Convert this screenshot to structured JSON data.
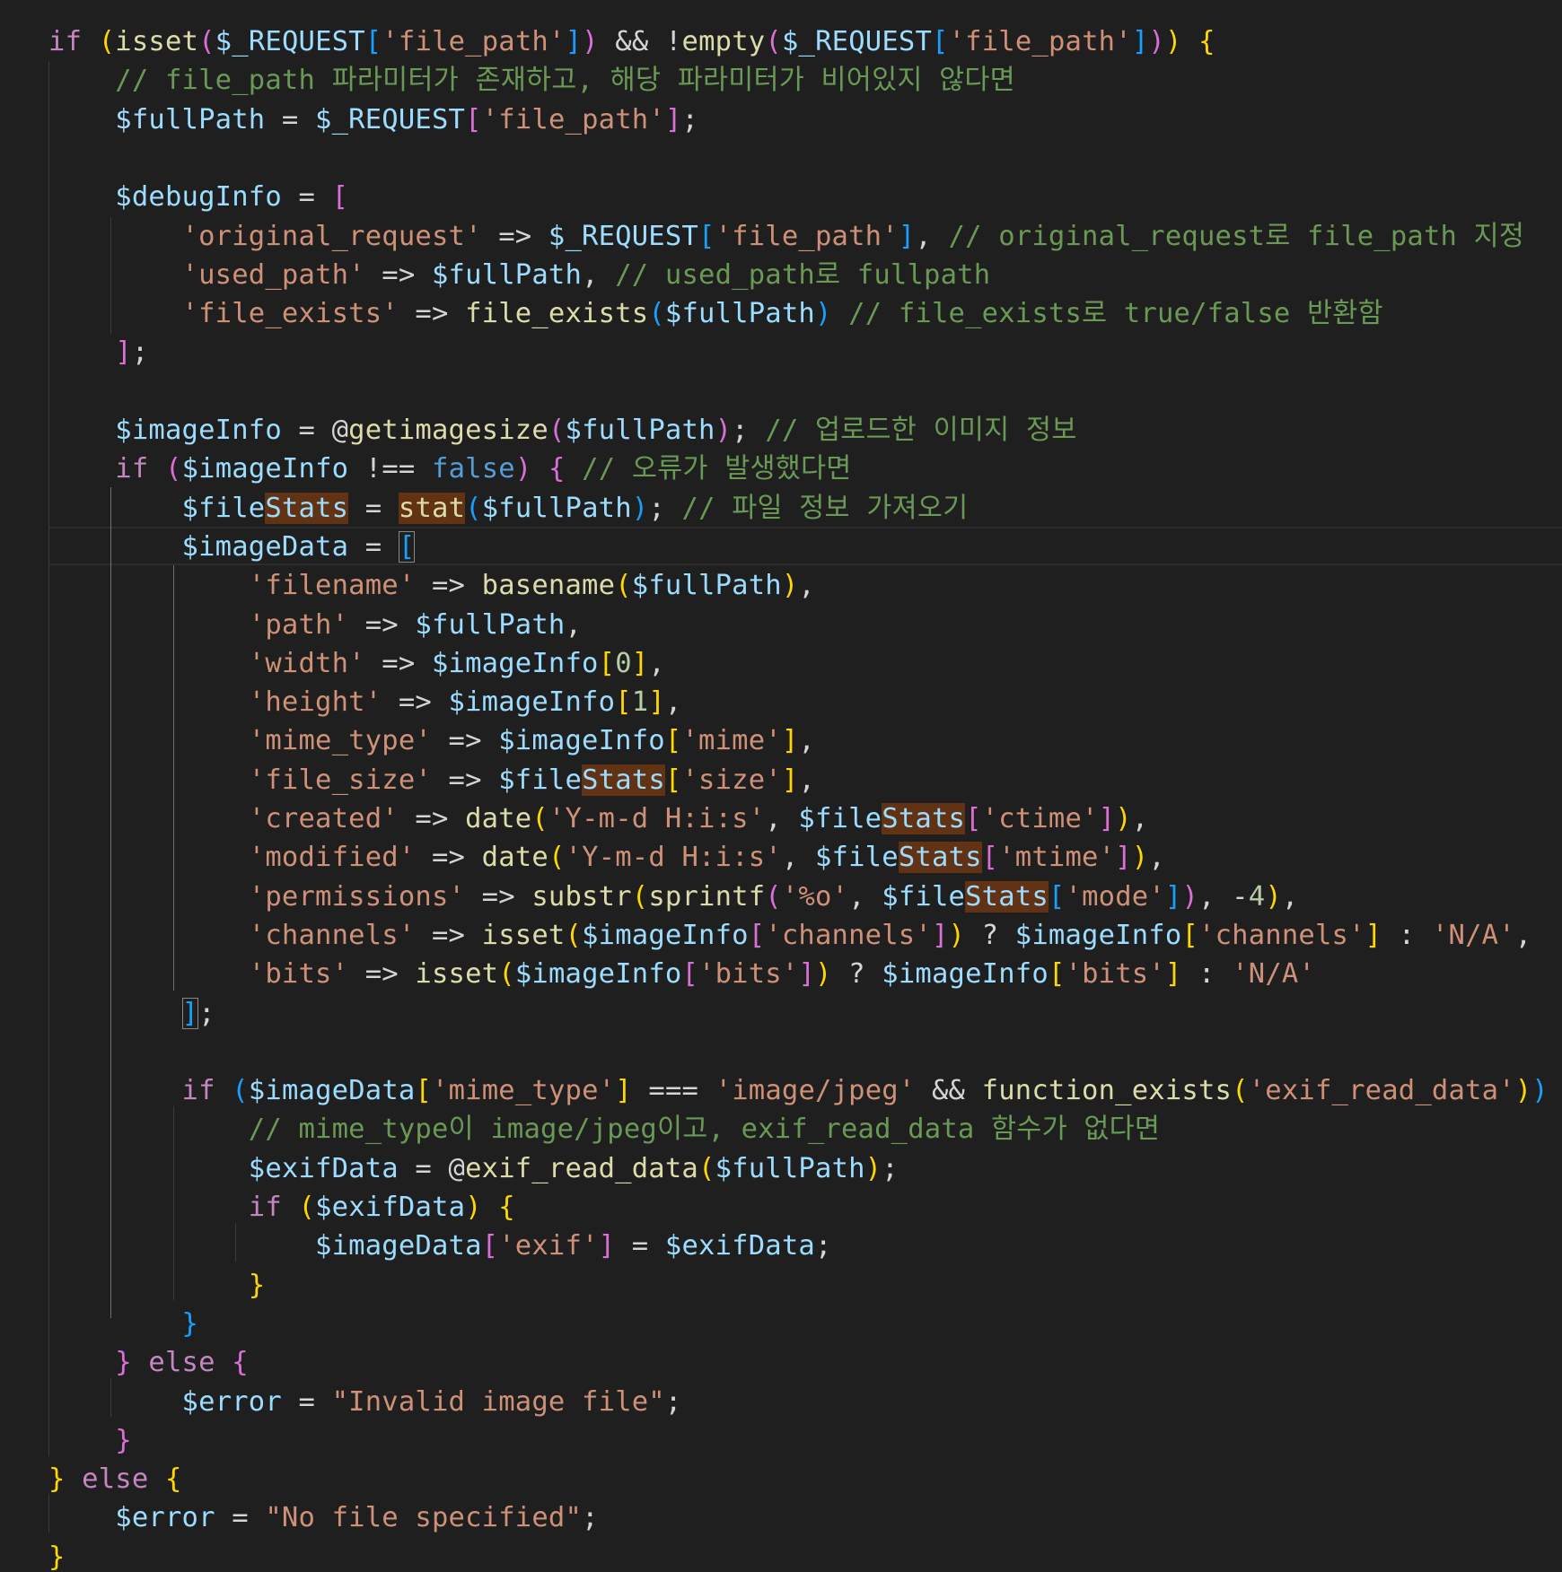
{
  "editor": {
    "language": "php",
    "lines": [
      [
        [
          "if",
          "kw"
        ],
        [
          " ",
          "op"
        ],
        [
          "(",
          "p1"
        ],
        [
          "isset",
          "fn"
        ],
        [
          "(",
          "p2"
        ],
        [
          "$_REQUEST",
          "var"
        ],
        [
          "[",
          "p3"
        ],
        [
          "'file_path'",
          "str"
        ],
        [
          "]",
          "p3"
        ],
        [
          ")",
          "p2"
        ],
        [
          " && !",
          "op"
        ],
        [
          "empty",
          "fn"
        ],
        [
          "(",
          "p2"
        ],
        [
          "$_REQUEST",
          "var"
        ],
        [
          "[",
          "p3"
        ],
        [
          "'file_path'",
          "str"
        ],
        [
          "]",
          "p3"
        ],
        [
          ")",
          "p2"
        ],
        [
          ")",
          "p1"
        ],
        [
          " ",
          "op"
        ],
        [
          "{",
          "p1"
        ]
      ],
      [
        [
          "    ",
          "op"
        ],
        [
          "// file_path 파라미터가 존재하고, 해당 파라미터가 비어있지 않다면",
          "cm"
        ]
      ],
      [
        [
          "    ",
          "op"
        ],
        [
          "$fullPath",
          "var"
        ],
        [
          " = ",
          "op"
        ],
        [
          "$_REQUEST",
          "var"
        ],
        [
          "[",
          "p2"
        ],
        [
          "'file_path'",
          "str"
        ],
        [
          "]",
          "p2"
        ],
        [
          ";",
          "op"
        ]
      ],
      [],
      [
        [
          "    ",
          "op"
        ],
        [
          "$debugInfo",
          "var"
        ],
        [
          " = ",
          "op"
        ],
        [
          "[",
          "p2"
        ]
      ],
      [
        [
          "        ",
          "op"
        ],
        [
          "'original_request'",
          "str"
        ],
        [
          " => ",
          "op"
        ],
        [
          "$_REQUEST",
          "var"
        ],
        [
          "[",
          "p3"
        ],
        [
          "'file_path'",
          "str"
        ],
        [
          "]",
          "p3"
        ],
        [
          ", ",
          "op"
        ],
        [
          "// original_request로 file_path 지정",
          "cm"
        ]
      ],
      [
        [
          "        ",
          "op"
        ],
        [
          "'used_path'",
          "str"
        ],
        [
          " => ",
          "op"
        ],
        [
          "$fullPath",
          "var"
        ],
        [
          ", ",
          "op"
        ],
        [
          "// used_path로 fullpath",
          "cm"
        ]
      ],
      [
        [
          "        ",
          "op"
        ],
        [
          "'file_exists'",
          "str"
        ],
        [
          " => ",
          "op"
        ],
        [
          "file_exists",
          "fn"
        ],
        [
          "(",
          "p3"
        ],
        [
          "$fullPath",
          "var"
        ],
        [
          ")",
          "p3"
        ],
        [
          " ",
          "op"
        ],
        [
          "// file_exists로 true/false 반환함",
          "cm"
        ]
      ],
      [
        [
          "    ",
          "op"
        ],
        [
          "]",
          "p2"
        ],
        [
          ";",
          "op"
        ]
      ],
      [],
      [
        [
          "    ",
          "op"
        ],
        [
          "$imageInfo",
          "var"
        ],
        [
          " = @",
          "op"
        ],
        [
          "getimagesize",
          "fn"
        ],
        [
          "(",
          "p2"
        ],
        [
          "$fullPath",
          "var"
        ],
        [
          ")",
          "p2"
        ],
        [
          "; ",
          "op"
        ],
        [
          "// 업로드한 이미지 정보",
          "cm"
        ]
      ],
      [
        [
          "    ",
          "op"
        ],
        [
          "if",
          "ctrl"
        ],
        [
          " ",
          "op"
        ],
        [
          "(",
          "p2"
        ],
        [
          "$imageInfo",
          "var"
        ],
        [
          " !== ",
          "op"
        ],
        [
          "false",
          "const"
        ],
        [
          ")",
          "p2"
        ],
        [
          " ",
          "op"
        ],
        [
          "{",
          "p2"
        ],
        [
          " ",
          "op"
        ],
        [
          "// 오류가 발생했다면",
          "cm"
        ]
      ],
      [
        [
          "        ",
          "op"
        ],
        [
          "$file",
          "var"
        ],
        [
          "Stats",
          "var",
          "hl"
        ],
        [
          " = ",
          "op"
        ],
        [
          "stat",
          "fn",
          "hl"
        ],
        [
          "(",
          "p3"
        ],
        [
          "$fullPath",
          "var"
        ],
        [
          ")",
          "p3"
        ],
        [
          "; ",
          "op"
        ],
        [
          "// 파일 정보 가져오기",
          "cm"
        ]
      ],
      [
        [
          "        ",
          "op"
        ],
        [
          "$imageData",
          "var"
        ],
        [
          " = ",
          "op"
        ],
        [
          "[",
          "p3",
          "brk"
        ]
      ],
      [
        [
          "            ",
          "op"
        ],
        [
          "'filename'",
          "str"
        ],
        [
          " => ",
          "op"
        ],
        [
          "basename",
          "fn"
        ],
        [
          "(",
          "p1"
        ],
        [
          "$fullPath",
          "var"
        ],
        [
          ")",
          "p1"
        ],
        [
          ",",
          "op"
        ]
      ],
      [
        [
          "            ",
          "op"
        ],
        [
          "'path'",
          "str"
        ],
        [
          " => ",
          "op"
        ],
        [
          "$fullPath",
          "var"
        ],
        [
          ",",
          "op"
        ]
      ],
      [
        [
          "            ",
          "op"
        ],
        [
          "'width'",
          "str"
        ],
        [
          " => ",
          "op"
        ],
        [
          "$imageInfo",
          "var"
        ],
        [
          "[",
          "p1"
        ],
        [
          "0",
          "num"
        ],
        [
          "]",
          "p1"
        ],
        [
          ",",
          "op"
        ]
      ],
      [
        [
          "            ",
          "op"
        ],
        [
          "'height'",
          "str"
        ],
        [
          " => ",
          "op"
        ],
        [
          "$imageInfo",
          "var"
        ],
        [
          "[",
          "p1"
        ],
        [
          "1",
          "num"
        ],
        [
          "]",
          "p1"
        ],
        [
          ",",
          "op"
        ]
      ],
      [
        [
          "            ",
          "op"
        ],
        [
          "'mime_type'",
          "str"
        ],
        [
          " => ",
          "op"
        ],
        [
          "$imageInfo",
          "var"
        ],
        [
          "[",
          "p1"
        ],
        [
          "'mime'",
          "str"
        ],
        [
          "]",
          "p1"
        ],
        [
          ",",
          "op"
        ]
      ],
      [
        [
          "            ",
          "op"
        ],
        [
          "'file_size'",
          "str"
        ],
        [
          " => ",
          "op"
        ],
        [
          "$file",
          "var"
        ],
        [
          "Stats",
          "var",
          "hl"
        ],
        [
          "[",
          "p1"
        ],
        [
          "'size'",
          "str"
        ],
        [
          "]",
          "p1"
        ],
        [
          ",",
          "op"
        ]
      ],
      [
        [
          "            ",
          "op"
        ],
        [
          "'created'",
          "str"
        ],
        [
          " => ",
          "op"
        ],
        [
          "date",
          "fn"
        ],
        [
          "(",
          "p1"
        ],
        [
          "'Y-m-d H:i:s'",
          "str"
        ],
        [
          ", ",
          "op"
        ],
        [
          "$file",
          "var"
        ],
        [
          "Stats",
          "var",
          "hl"
        ],
        [
          "[",
          "p2"
        ],
        [
          "'ctime'",
          "str"
        ],
        [
          "]",
          "p2"
        ],
        [
          ")",
          "p1"
        ],
        [
          ",",
          "op"
        ]
      ],
      [
        [
          "            ",
          "op"
        ],
        [
          "'modified'",
          "str"
        ],
        [
          " => ",
          "op"
        ],
        [
          "date",
          "fn"
        ],
        [
          "(",
          "p1"
        ],
        [
          "'Y-m-d H:i:s'",
          "str"
        ],
        [
          ", ",
          "op"
        ],
        [
          "$file",
          "var"
        ],
        [
          "Stats",
          "var",
          "hl"
        ],
        [
          "[",
          "p2"
        ],
        [
          "'mtime'",
          "str"
        ],
        [
          "]",
          "p2"
        ],
        [
          ")",
          "p1"
        ],
        [
          ",",
          "op"
        ]
      ],
      [
        [
          "            ",
          "op"
        ],
        [
          "'permissions'",
          "str"
        ],
        [
          " => ",
          "op"
        ],
        [
          "substr",
          "fn"
        ],
        [
          "(",
          "p1"
        ],
        [
          "sprintf",
          "fn"
        ],
        [
          "(",
          "p2"
        ],
        [
          "'%o'",
          "str"
        ],
        [
          ", ",
          "op"
        ],
        [
          "$file",
          "var"
        ],
        [
          "Stats",
          "var",
          "hl"
        ],
        [
          "[",
          "p3"
        ],
        [
          "'mode'",
          "str"
        ],
        [
          "]",
          "p3"
        ],
        [
          ")",
          "p2"
        ],
        [
          ", -",
          "op"
        ],
        [
          "4",
          "num"
        ],
        [
          ")",
          "p1"
        ],
        [
          ",",
          "op"
        ]
      ],
      [
        [
          "            ",
          "op"
        ],
        [
          "'channels'",
          "str"
        ],
        [
          " => ",
          "op"
        ],
        [
          "isset",
          "fn"
        ],
        [
          "(",
          "p1"
        ],
        [
          "$imageInfo",
          "var"
        ],
        [
          "[",
          "p2"
        ],
        [
          "'channels'",
          "str"
        ],
        [
          "]",
          "p2"
        ],
        [
          ")",
          "p1"
        ],
        [
          " ? ",
          "op"
        ],
        [
          "$imageInfo",
          "var"
        ],
        [
          "[",
          "p1"
        ],
        [
          "'channels'",
          "str"
        ],
        [
          "]",
          "p1"
        ],
        [
          " : ",
          "op"
        ],
        [
          "'N/A'",
          "str"
        ],
        [
          ",",
          "op"
        ]
      ],
      [
        [
          "            ",
          "op"
        ],
        [
          "'bits'",
          "str"
        ],
        [
          " => ",
          "op"
        ],
        [
          "isset",
          "fn"
        ],
        [
          "(",
          "p1"
        ],
        [
          "$imageInfo",
          "var"
        ],
        [
          "[",
          "p2"
        ],
        [
          "'bits'",
          "str"
        ],
        [
          "]",
          "p2"
        ],
        [
          ")",
          "p1"
        ],
        [
          " ? ",
          "op"
        ],
        [
          "$imageInfo",
          "var"
        ],
        [
          "[",
          "p1"
        ],
        [
          "'bits'",
          "str"
        ],
        [
          "]",
          "p1"
        ],
        [
          " : ",
          "op"
        ],
        [
          "'N/A'",
          "str"
        ]
      ],
      [
        [
          "        ",
          "op"
        ],
        [
          "]",
          "p3",
          "brk"
        ],
        [
          ";",
          "op"
        ]
      ],
      [],
      [
        [
          "        ",
          "op"
        ],
        [
          "if",
          "ctrl"
        ],
        [
          " ",
          "op"
        ],
        [
          "(",
          "p3"
        ],
        [
          "$imageData",
          "var"
        ],
        [
          "[",
          "p1"
        ],
        [
          "'mime_type'",
          "str"
        ],
        [
          "]",
          "p1"
        ],
        [
          " === ",
          "op"
        ],
        [
          "'image/jpeg'",
          "str"
        ],
        [
          " && ",
          "op"
        ],
        [
          "function_exists",
          "fn"
        ],
        [
          "(",
          "p1"
        ],
        [
          "'exif_read_data'",
          "str"
        ],
        [
          ")",
          "p1"
        ],
        [
          ")",
          "p3"
        ],
        [
          " ",
          "op"
        ],
        [
          "{",
          "p3"
        ]
      ],
      [
        [
          "            ",
          "op"
        ],
        [
          "// mime_type이 image/jpeg이고, exif_read_data 함수가 없다면",
          "cm"
        ]
      ],
      [
        [
          "            ",
          "op"
        ],
        [
          "$exifData",
          "var"
        ],
        [
          " = @",
          "op"
        ],
        [
          "exif_read_data",
          "fn"
        ],
        [
          "(",
          "p1"
        ],
        [
          "$fullPath",
          "var"
        ],
        [
          ")",
          "p1"
        ],
        [
          ";",
          "op"
        ]
      ],
      [
        [
          "            ",
          "op"
        ],
        [
          "if",
          "ctrl"
        ],
        [
          " ",
          "op"
        ],
        [
          "(",
          "p1"
        ],
        [
          "$exifData",
          "var"
        ],
        [
          ")",
          "p1"
        ],
        [
          " ",
          "op"
        ],
        [
          "{",
          "p1"
        ]
      ],
      [
        [
          "                ",
          "op"
        ],
        [
          "$imageData",
          "var"
        ],
        [
          "[",
          "p2"
        ],
        [
          "'exif'",
          "str"
        ],
        [
          "]",
          "p2"
        ],
        [
          " = ",
          "op"
        ],
        [
          "$exifData",
          "var"
        ],
        [
          ";",
          "op"
        ]
      ],
      [
        [
          "            ",
          "op"
        ],
        [
          "}",
          "p1"
        ]
      ],
      [
        [
          "        ",
          "op"
        ],
        [
          "}",
          "p3"
        ]
      ],
      [
        [
          "    ",
          "op"
        ],
        [
          "}",
          "p2"
        ],
        [
          " ",
          "op"
        ],
        [
          "else",
          "ctrl"
        ],
        [
          " ",
          "op"
        ],
        [
          "{",
          "p2"
        ]
      ],
      [
        [
          "        ",
          "op"
        ],
        [
          "$error",
          "var"
        ],
        [
          " = ",
          "op"
        ],
        [
          "\"Invalid image file\"",
          "str"
        ],
        [
          ";",
          "op"
        ]
      ],
      [
        [
          "    ",
          "op"
        ],
        [
          "}",
          "p2"
        ]
      ],
      [
        [
          "}",
          "p1"
        ],
        [
          " ",
          "op"
        ],
        [
          "else",
          "ctrl"
        ],
        [
          " ",
          "op"
        ],
        [
          "{",
          "p1"
        ]
      ],
      [
        [
          "    ",
          "op"
        ],
        [
          "$error",
          "var"
        ],
        [
          " = ",
          "op"
        ],
        [
          "\"No file specified\"",
          "str"
        ],
        [
          ";",
          "op"
        ]
      ],
      [
        [
          "}",
          "p1"
        ]
      ]
    ]
  }
}
